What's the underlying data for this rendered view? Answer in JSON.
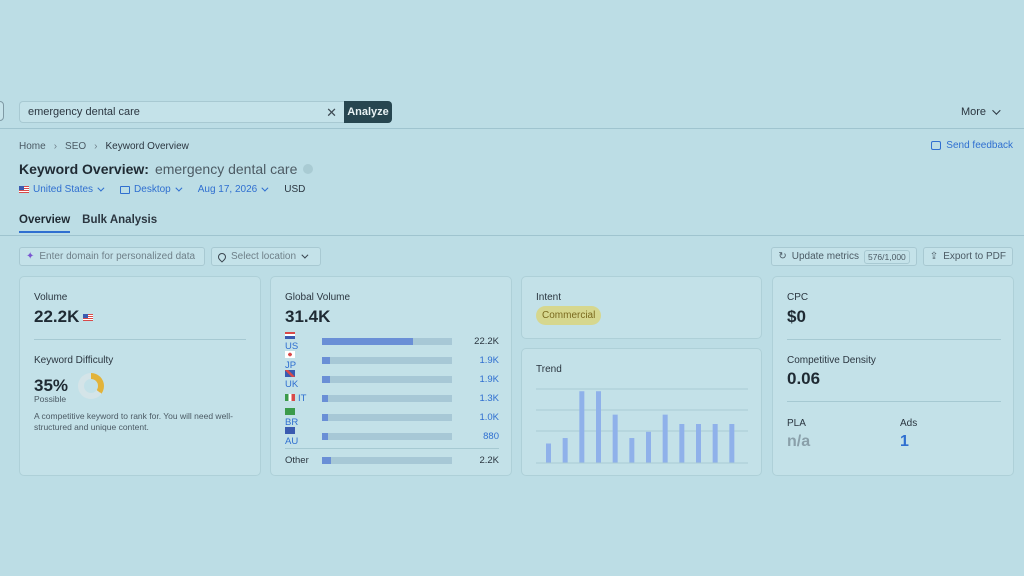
{
  "search": {
    "value": "emergency dental care",
    "clear_icon": "close-icon",
    "analyze_label": "Analyze"
  },
  "top_nav": {
    "more_label": "More"
  },
  "breadcrumb": [
    "Home",
    "SEO",
    "Keyword Overview"
  ],
  "feedback_label": "Send feedback",
  "page": {
    "title_prefix": "Keyword Overview:",
    "keyword": "emergency dental care"
  },
  "filters": {
    "country": "United States",
    "device": "Desktop",
    "date": "Aug 17, 2026",
    "currency": "USD"
  },
  "tabs": [
    "Overview",
    "Bulk Analysis"
  ],
  "toolbar": {
    "domain_placeholder": "Enter domain for personalized data",
    "location_placeholder": "Select location",
    "update_label": "Update metrics",
    "update_count": "576/1,000",
    "export_label": "Export to PDF"
  },
  "volume_card": {
    "volume_label": "Volume",
    "volume_value": "22.2K",
    "kd_label": "Keyword Difficulty",
    "kd_value": "35%",
    "kd_percent": 35,
    "kd_status": "Possible",
    "kd_description": "A competitive keyword to rank for. You will need well-structured and unique content."
  },
  "global_card": {
    "label": "Global Volume",
    "value": "31.4K",
    "rows": [
      {
        "code": "US",
        "value": "22.2K",
        "share": 0.7
      },
      {
        "code": "JP",
        "value": "1.9K",
        "share": 0.06
      },
      {
        "code": "UK",
        "value": "1.9K",
        "share": 0.06
      },
      {
        "code": "IT",
        "value": "1.3K",
        "share": 0.04
      },
      {
        "code": "BR",
        "value": "1.0K",
        "share": 0.03
      },
      {
        "code": "AU",
        "value": "880",
        "share": 0.03
      }
    ],
    "other_label": "Other",
    "other_value": "2.2K",
    "other_share": 0.07
  },
  "intent_card": {
    "label": "Intent",
    "value": "Commercial"
  },
  "trend_card": {
    "label": "Trend",
    "values": [
      0.25,
      0.32,
      0.92,
      0.92,
      0.62,
      0.32,
      0.4,
      0.62,
      0.5,
      0.5,
      0.5,
      0.5
    ]
  },
  "cpc_card": {
    "cpc_label": "CPC",
    "cpc_value": "$0",
    "density_label": "Competitive Density",
    "density_value": "0.06",
    "pla_label": "PLA",
    "pla_value": "n/a",
    "ads_label": "Ads",
    "ads_value": "1"
  },
  "colors": {
    "accent": "#2f6fd0",
    "bar": "#6a8fd6",
    "intent": "#d6d78e",
    "kd": "#e2b33a"
  }
}
